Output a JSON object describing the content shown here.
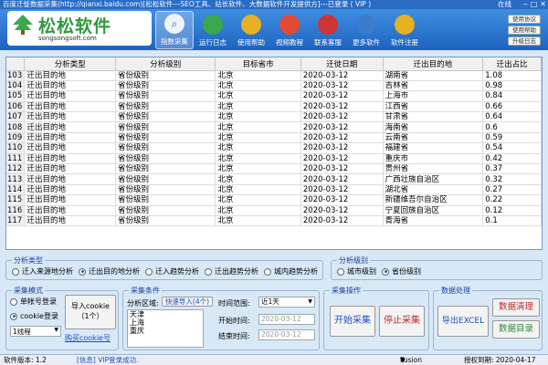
{
  "window": {
    "title": "百度迁徙数据采集(http://qianxi.baidu.com)[松松软件---SEO工具、站长软件、大数据软件开发提供方]---已登录 ( VIP )",
    "status": "在线"
  },
  "logo": {
    "name": "松松软件",
    "url": "songsongsoft.com"
  },
  "toolbar": [
    {
      "label": "指数采集",
      "icon": "magnifier-icon",
      "color": "#eef3fa"
    },
    {
      "label": "运行日志",
      "icon": "log-icon",
      "color": "#3aa84a"
    },
    {
      "label": "使用帮助",
      "icon": "help-icon",
      "color": "#e8b023"
    },
    {
      "label": "视频教程",
      "icon": "video-icon",
      "color": "#e34a34"
    },
    {
      "label": "联系客服",
      "icon": "contact-icon",
      "color": "#cf3434"
    },
    {
      "label": "更多软件",
      "icon": "more-icon",
      "color": "#3b7bd0"
    },
    {
      "label": "软件注册",
      "icon": "register-icon",
      "color": "#e8b023"
    }
  ],
  "side_buttons": [
    "使用协议",
    "使用帮助",
    "升级日志"
  ],
  "table": {
    "headers": [
      "",
      "分析类型",
      "分析级别",
      "目标省市",
      "迁徙日期",
      "迁出目的地",
      "迁出占比"
    ],
    "rows": [
      [
        "103",
        "迁出目的地",
        "省份级别",
        "北京",
        "2020-03-12",
        "湖南省",
        "1.08"
      ],
      [
        "104",
        "迁出目的地",
        "省份级别",
        "北京",
        "2020-03-12",
        "吉林省",
        "0.98"
      ],
      [
        "105",
        "迁出目的地",
        "省份级别",
        "北京",
        "2020-03-12",
        "上海市",
        "0.84"
      ],
      [
        "106",
        "迁出目的地",
        "省份级别",
        "北京",
        "2020-03-12",
        "江西省",
        "0.66"
      ],
      [
        "107",
        "迁出目的地",
        "省份级别",
        "北京",
        "2020-03-12",
        "甘肃省",
        "0.64"
      ],
      [
        "108",
        "迁出目的地",
        "省份级别",
        "北京",
        "2020-03-12",
        "海南省",
        "0.6"
      ],
      [
        "109",
        "迁出目的地",
        "省份级别",
        "北京",
        "2020-03-12",
        "云南省",
        "0.59"
      ],
      [
        "110",
        "迁出目的地",
        "省份级别",
        "北京",
        "2020-03-12",
        "福建省",
        "0.54"
      ],
      [
        "111",
        "迁出目的地",
        "省份级别",
        "北京",
        "2020-03-12",
        "重庆市",
        "0.42"
      ],
      [
        "112",
        "迁出目的地",
        "省份级别",
        "北京",
        "2020-03-12",
        "贵州省",
        "0.37"
      ],
      [
        "113",
        "迁出目的地",
        "省份级别",
        "北京",
        "2020-03-12",
        "广西壮族自治区",
        "0.32"
      ],
      [
        "114",
        "迁出目的地",
        "省份级别",
        "北京",
        "2020-03-12",
        "湖北省",
        "0.27"
      ],
      [
        "115",
        "迁出目的地",
        "省份级别",
        "北京",
        "2020-03-12",
        "新疆维吾尔自治区",
        "0.22"
      ],
      [
        "116",
        "迁出目的地",
        "省份级别",
        "北京",
        "2020-03-12",
        "宁夏回族自治区",
        "0.12"
      ],
      [
        "117",
        "迁出目的地",
        "省份级别",
        "北京",
        "2020-03-12",
        "青海省",
        "0.1"
      ]
    ]
  },
  "analysis_type": {
    "title": "分析类型",
    "options": [
      "迁入来源地分析",
      "迁出目的地分析",
      "迁入趋势分析",
      "迁出趋势分析",
      "城内趋势分析"
    ],
    "selected": 1
  },
  "analysis_level": {
    "title": "分析级别",
    "options": [
      "城市级别",
      "省份级别"
    ],
    "selected": 1
  },
  "collect_mode": {
    "title": "采集模式",
    "options": [
      "单帐号登录",
      "cookie登录"
    ],
    "selected": 1,
    "thread_value": "1线程",
    "import_button": "导入cookie\n（1个）",
    "buy_link": "购买cookie号"
  },
  "collect_conditions": {
    "title": "采集条件",
    "region_label": "分析区域:",
    "quick_import": "快速导入(4个)",
    "regions": [
      "天津",
      "上海",
      "重庆"
    ],
    "time_range_label": "时间范围:",
    "time_range_value": "近1天",
    "start_label": "开始时间:",
    "start_value": "2020-03-12",
    "end_label": "结束时间:",
    "end_value": "2020-03-12"
  },
  "collect_ops": {
    "title": "采集操作",
    "start": "开始采集",
    "stop": "停止采集"
  },
  "data_proc": {
    "title": "数据处理",
    "export": "导出EXCEL",
    "clean": "数据清理",
    "dir": "数据目录"
  },
  "statusbar": {
    "version": "软件版本: 1.2",
    "message": "[信息] VIP登录成功.",
    "theme": "Fusion",
    "expiry": "授权到期: 2020-04-17"
  }
}
